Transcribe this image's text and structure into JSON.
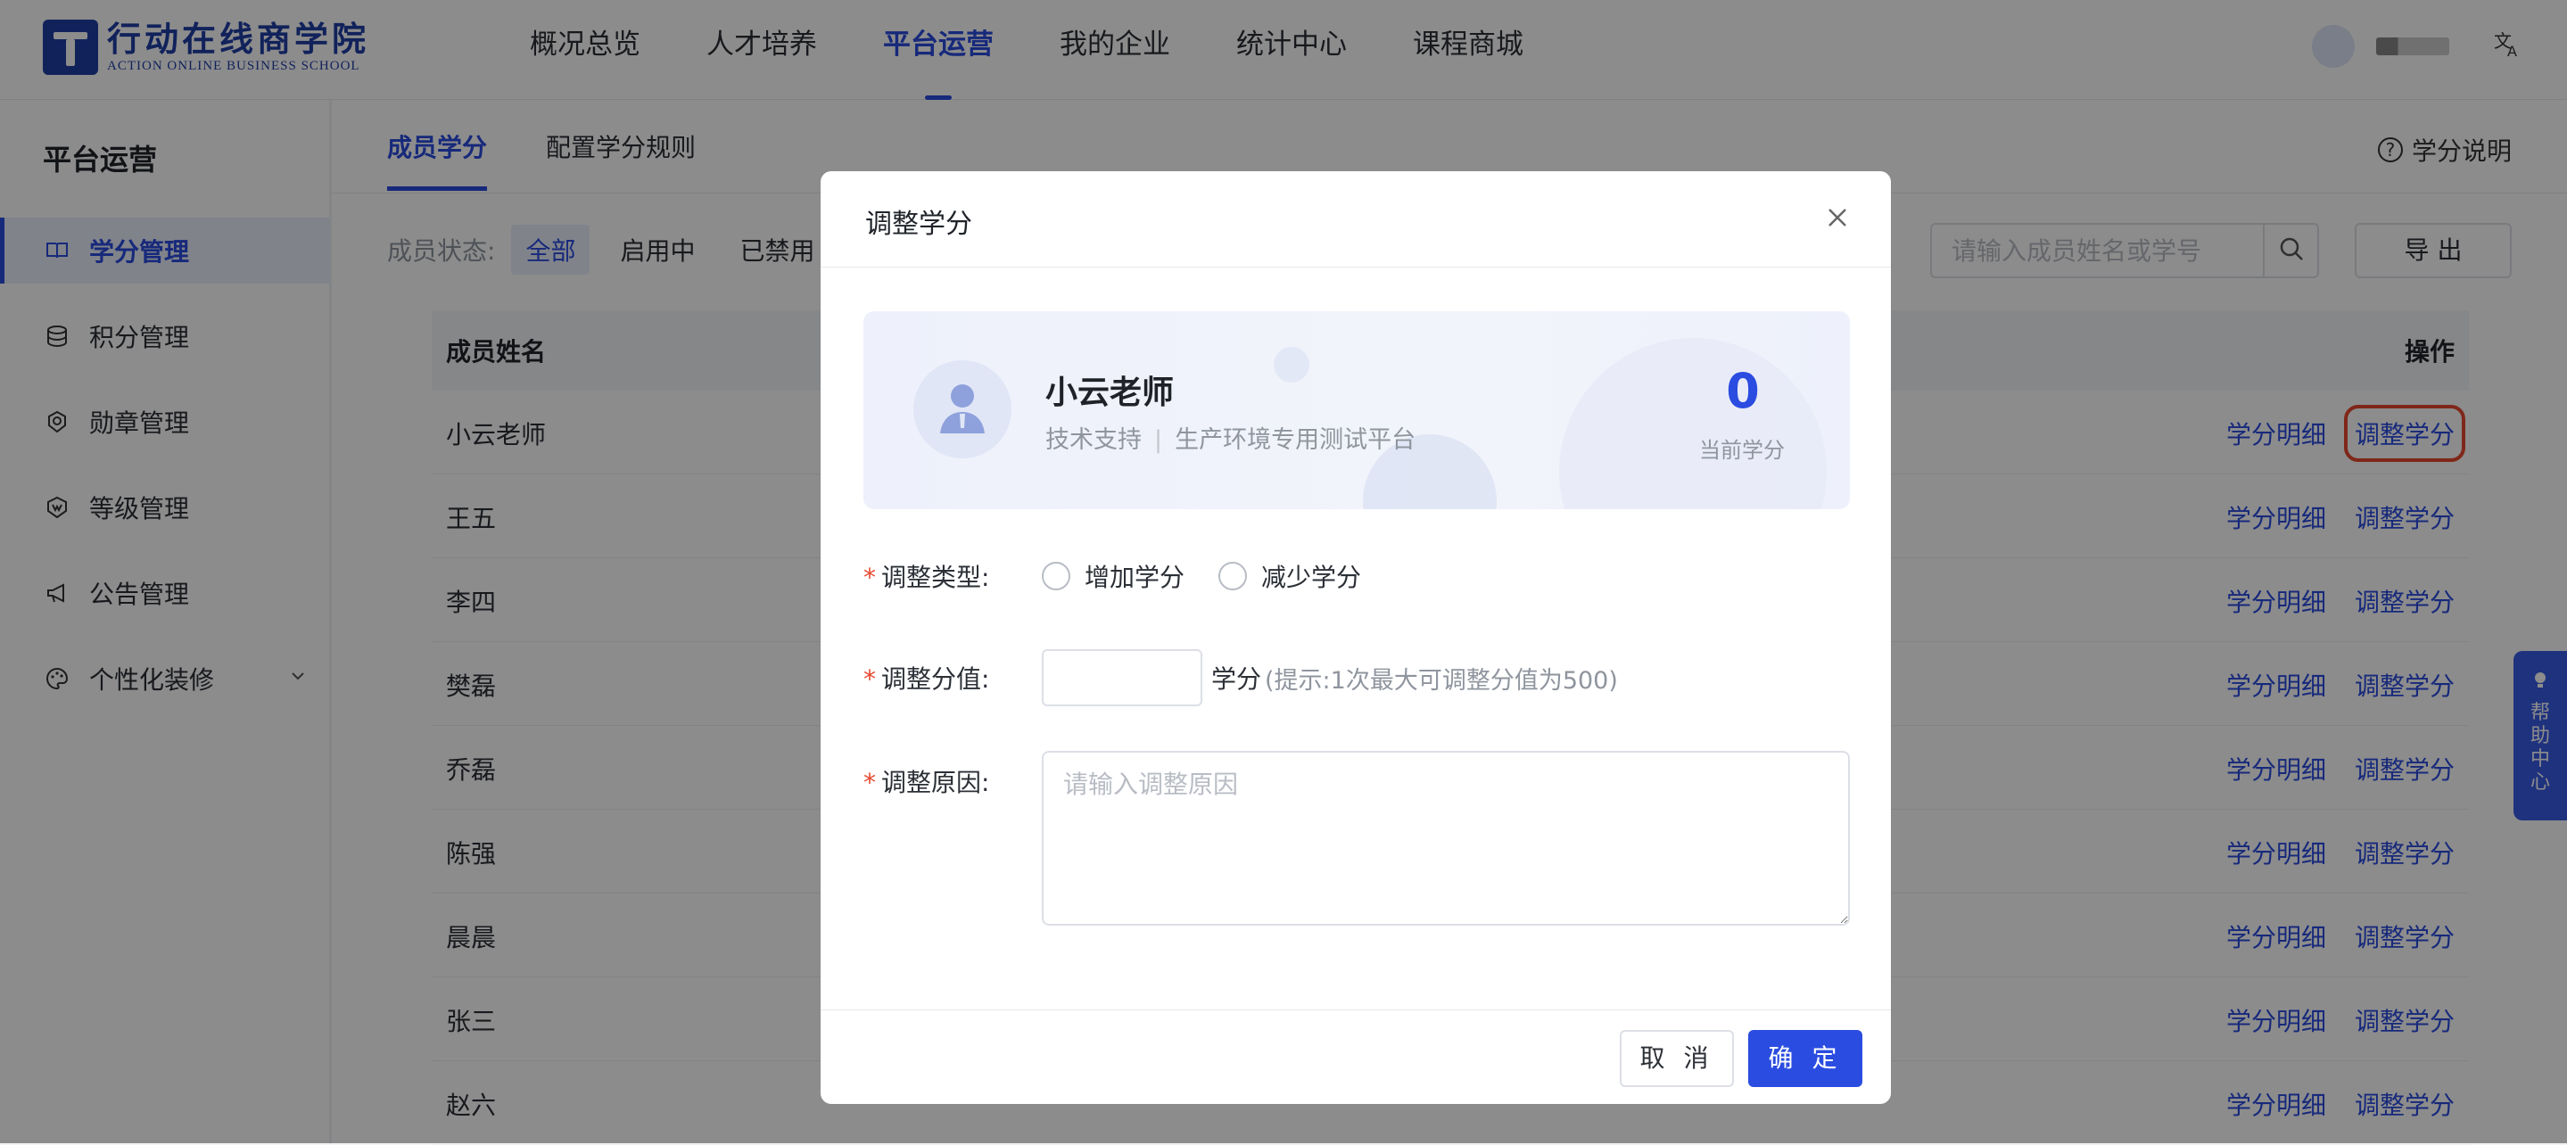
{
  "brand": {
    "name_cn": "行动在线商学院",
    "name_en": "ACTION ONLINE BUSINESS SCHOOL",
    "accent": "#2a4ce0"
  },
  "nav": {
    "items": [
      "概况总览",
      "人才培养",
      "平台运营",
      "我的企业",
      "统计中心",
      "课程商城"
    ],
    "active": "平台运营"
  },
  "sidebar": {
    "title": "平台运营",
    "items": [
      {
        "label": "学分管理",
        "icon": "book-icon"
      },
      {
        "label": "积分管理",
        "icon": "database-icon"
      },
      {
        "label": "勋章管理",
        "icon": "medal-icon"
      },
      {
        "label": "等级管理",
        "icon": "level-icon"
      },
      {
        "label": "公告管理",
        "icon": "megaphone-icon"
      },
      {
        "label": "个性化装修",
        "icon": "palette-icon"
      }
    ]
  },
  "tabs": [
    "成员学分",
    "配置学分规则"
  ],
  "help_link": "学分说明",
  "filter": {
    "label": "成员状态:",
    "options": [
      "全部",
      "启用中",
      "已禁用"
    ]
  },
  "search": {
    "placeholder": "请输入成员姓名或学号"
  },
  "export_label": "导 出",
  "table": {
    "col_name": "成员姓名",
    "col_action": "操作",
    "action_detail": "学分明细",
    "action_adjust": "调整学分",
    "rows": [
      {
        "name": "小云老师"
      },
      {
        "name": "王五"
      },
      {
        "name": "李四"
      },
      {
        "name": "樊磊"
      },
      {
        "name": "乔磊"
      },
      {
        "name": "陈强"
      },
      {
        "name": "晨晨"
      },
      {
        "name": "张三"
      },
      {
        "name": "赵六"
      }
    ]
  },
  "float_help": "帮助中心",
  "modal": {
    "title": "调整学分",
    "member": {
      "name": "小云老师",
      "dept": "技术支持",
      "sep": "|",
      "org": "生产环境专用测试平台",
      "credits": "0",
      "credits_label": "当前学分"
    },
    "type": {
      "label": "调整类型:",
      "options": [
        "增加学分",
        "减少学分"
      ]
    },
    "value": {
      "label": "调整分值:",
      "value": "",
      "unit": "学分",
      "hint": "(提示:1次最大可调整分值为500)"
    },
    "reason": {
      "label": "调整原因:",
      "placeholder": "请输入调整原因"
    },
    "cancel": "取 消",
    "ok": "确 定"
  }
}
